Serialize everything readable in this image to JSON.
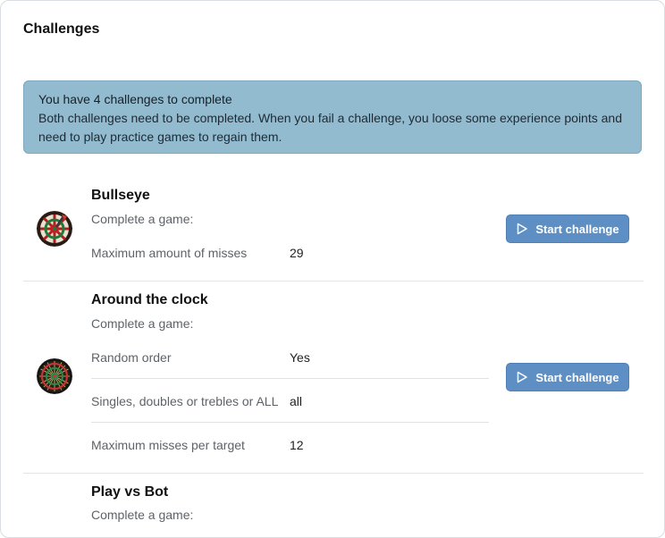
{
  "page": {
    "title": "Challenges"
  },
  "banner": {
    "title": "You have 4 challenges to complete",
    "message": "Both challenges need to be completed. When you fail a challenge, you loose some experience points and need to play practice games to regain them."
  },
  "challenges": [
    {
      "name": "Bullseye",
      "subtitle": "Complete a game:",
      "rows": [
        {
          "label": "Maximum amount of misses",
          "value": "29"
        }
      ],
      "button_label": "Start challenge",
      "icon": "play-icon"
    },
    {
      "name": "Around the clock",
      "subtitle": "Complete a game:",
      "rows": [
        {
          "label": "Random order",
          "value": "Yes"
        },
        {
          "label": "Singles, doubles or trebles or ALL",
          "value": "all"
        },
        {
          "label": "Maximum misses per target",
          "value": "12"
        }
      ],
      "button_label": "Start challenge",
      "icon": "play-icon"
    },
    {
      "name": "Play vs Bot",
      "subtitle": "Complete a game:"
    }
  ],
  "colors": {
    "banner_bg": "#92bbd0",
    "button_bg": "#5e8fc4"
  }
}
